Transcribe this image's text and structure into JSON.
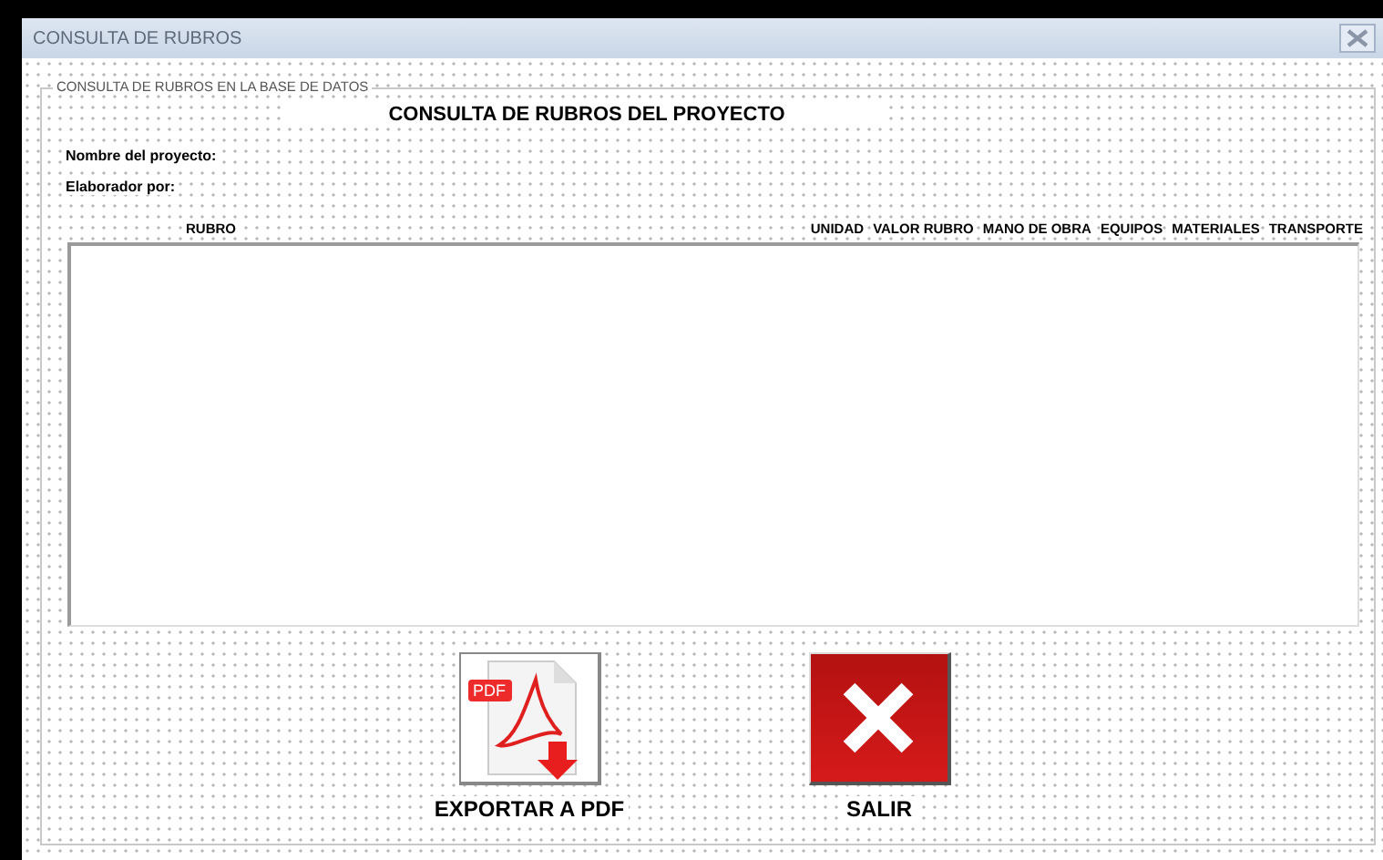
{
  "window": {
    "title": "CONSULTA DE RUBROS"
  },
  "frame": {
    "caption": "CONSULTA DE RUBROS EN LA BASE DE DATOS",
    "heading": "CONSULTA DE RUBROS DEL PROYECTO"
  },
  "fields": [
    {
      "label": "Nombre del proyecto:"
    },
    {
      "label": "Elaborador por:"
    }
  ],
  "table": {
    "columns": [
      "RUBRO",
      "UNIDAD",
      "VALOR RUBRO",
      "MANO DE OBRA",
      "EQUIPOS",
      "MATERIALES",
      "TRANSPORTE"
    ]
  },
  "buttons": [
    {
      "kind": "pdf",
      "label": "EXPORTAR A PDF",
      "icon_text": "PDF"
    },
    {
      "kind": "exit",
      "label": "SALIR"
    }
  ]
}
